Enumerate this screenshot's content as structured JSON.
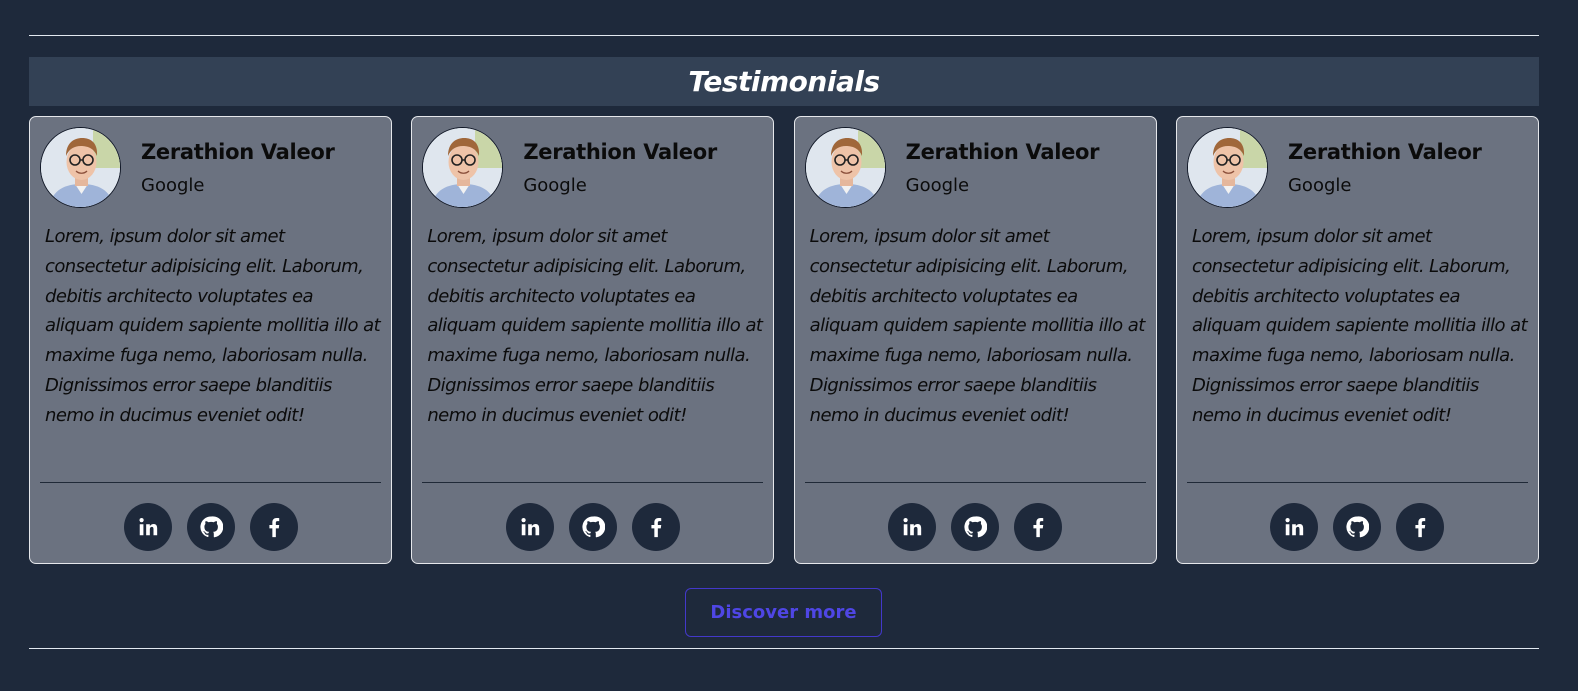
{
  "section": {
    "title": "Testimonials"
  },
  "testimonials": [
    {
      "name": "Zerathion Valeor",
      "company": "Google",
      "quote": "Lorem, ipsum dolor sit amet consectetur adipisicing elit. Laborum, debitis architecto voluptates ea aliquam quidem sapiente mollitia illo at maxime fuga nemo, laboriosam nulla. Dignissimos error saepe blanditiis nemo in ducimus eveniet odit!",
      "socials": [
        "linkedin-icon",
        "github-icon",
        "facebook-icon"
      ]
    },
    {
      "name": "Zerathion Valeor",
      "company": "Google",
      "quote": "Lorem, ipsum dolor sit amet consectetur adipisicing elit. Laborum, debitis architecto voluptates ea aliquam quidem sapiente mollitia illo at maxime fuga nemo, laboriosam nulla. Dignissimos error saepe blanditiis nemo in ducimus eveniet odit!",
      "socials": [
        "linkedin-icon",
        "github-icon",
        "facebook-icon"
      ]
    },
    {
      "name": "Zerathion Valeor",
      "company": "Google",
      "quote": "Lorem, ipsum dolor sit amet consectetur adipisicing elit. Laborum, debitis architecto voluptates ea aliquam quidem sapiente mollitia illo at maxime fuga nemo, laboriosam nulla. Dignissimos error saepe blanditiis nemo in ducimus eveniet odit!",
      "socials": [
        "linkedin-icon",
        "github-icon",
        "facebook-icon"
      ]
    },
    {
      "name": "Zerathion Valeor",
      "company": "Google",
      "quote": "Lorem, ipsum dolor sit amet consectetur adipisicing elit. Laborum, debitis architecto voluptates ea aliquam quidem sapiente mollitia illo at maxime fuga nemo, laboriosam nulla. Dignissimos error saepe blanditiis nemo in ducimus eveniet odit!",
      "socials": [
        "linkedin-icon",
        "github-icon",
        "facebook-icon"
      ]
    }
  ],
  "actions": {
    "discover_label": "Discover more"
  },
  "colors": {
    "page_background": "#1e293b",
    "title_bar": "#334155",
    "card_background": "#6b7280",
    "social_button": "#1e293b",
    "accent": "#4f46e5"
  }
}
